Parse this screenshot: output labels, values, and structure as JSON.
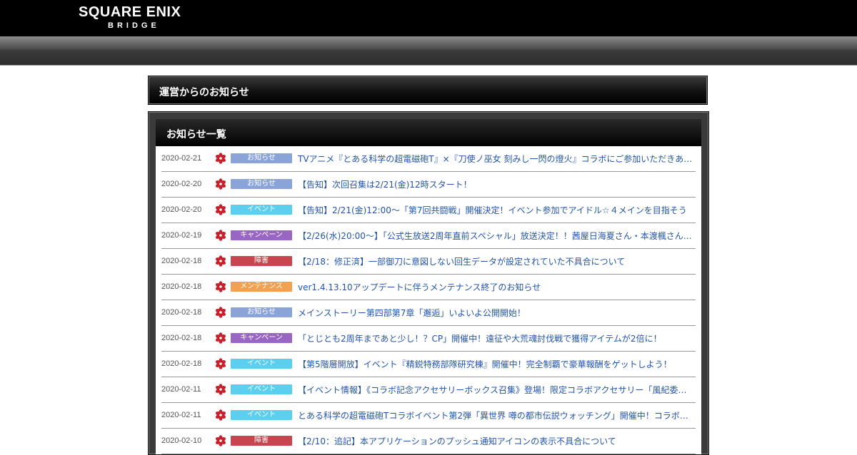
{
  "header": {
    "logo_main": "SQUARE ENIX",
    "logo_sub": "BRIDGE"
  },
  "panel": {
    "title": "運営からのお知らせ"
  },
  "notices": {
    "title": "お知らせ一覧",
    "category_colors": {
      "お知らせ": "#8aa3d8",
      "イベント": "#5ccfee",
      "キャンペーン": "#9a66c6",
      "障害": "#c8444f",
      "メンテナンス": "#f2a052"
    },
    "items": [
      {
        "date": "2020-02-21",
        "category": "お知らせ",
        "title": "TVアニメ『とある科学の超電磁砲T』×『刀使ノ巫女 刻みし一閃の燈火』コラボにご参加いただきありがとうございました"
      },
      {
        "date": "2020-02-20",
        "category": "お知らせ",
        "title": "【告知】次回召集は2/21(金)12時スタート！"
      },
      {
        "date": "2020-02-20",
        "category": "イベント",
        "title": "【告知】2/21(金)12:00～「第7回共闘戦」開催決定！イベント参加でアイドル☆４メインを目指そう"
      },
      {
        "date": "2020-02-19",
        "category": "キャンペーン",
        "title": "【2/26(水)20:00～】「公式生放送2周年直前スペシャル」放送決定！！茜屋日海夏さん・本渡楓さんが出演"
      },
      {
        "date": "2020-02-18",
        "category": "障害",
        "title": "【2/18：修正済】一部御刀に意図しない回生データが設定されていた不具合について"
      },
      {
        "date": "2020-02-18",
        "category": "メンテナンス",
        "title": "ver1.4.13.10アップデートに伴うメンテナンス終了のお知らせ"
      },
      {
        "date": "2020-02-18",
        "category": "お知らせ",
        "title": "メインストーリー第四部第7章「邂逅」いよいよ公開開始！"
      },
      {
        "date": "2020-02-18",
        "category": "キャンペーン",
        "title": "「とじとも2周年まであと少し！？CP」開催中！遠征や大荒魂討伐戦で獲得アイテムが2倍に！"
      },
      {
        "date": "2020-02-18",
        "category": "イベント",
        "title": "【第5階層開放】イベント『精鋭特務部隊研究棟』開催中！完全制覇で豪華報酬をゲットしよう！"
      },
      {
        "date": "2020-02-11",
        "category": "イベント",
        "title": "【イベント情報】《コラボ記念アクセサリーボックス召集》登場！限定コラボアクセサリー「風紀委員の腕章」"
      },
      {
        "date": "2020-02-11",
        "category": "イベント",
        "title": "とある科学の超電磁砲Tコラボイベント第2弾「異世界 噂の都市伝説ウォッチング」開催中！コラボ限定刀使も登場"
      },
      {
        "date": "2020-02-10",
        "category": "障害",
        "title": "【2/10：追記】本アプリケーションのプッシュ通知アイコンの表示不具合について"
      }
    ]
  }
}
